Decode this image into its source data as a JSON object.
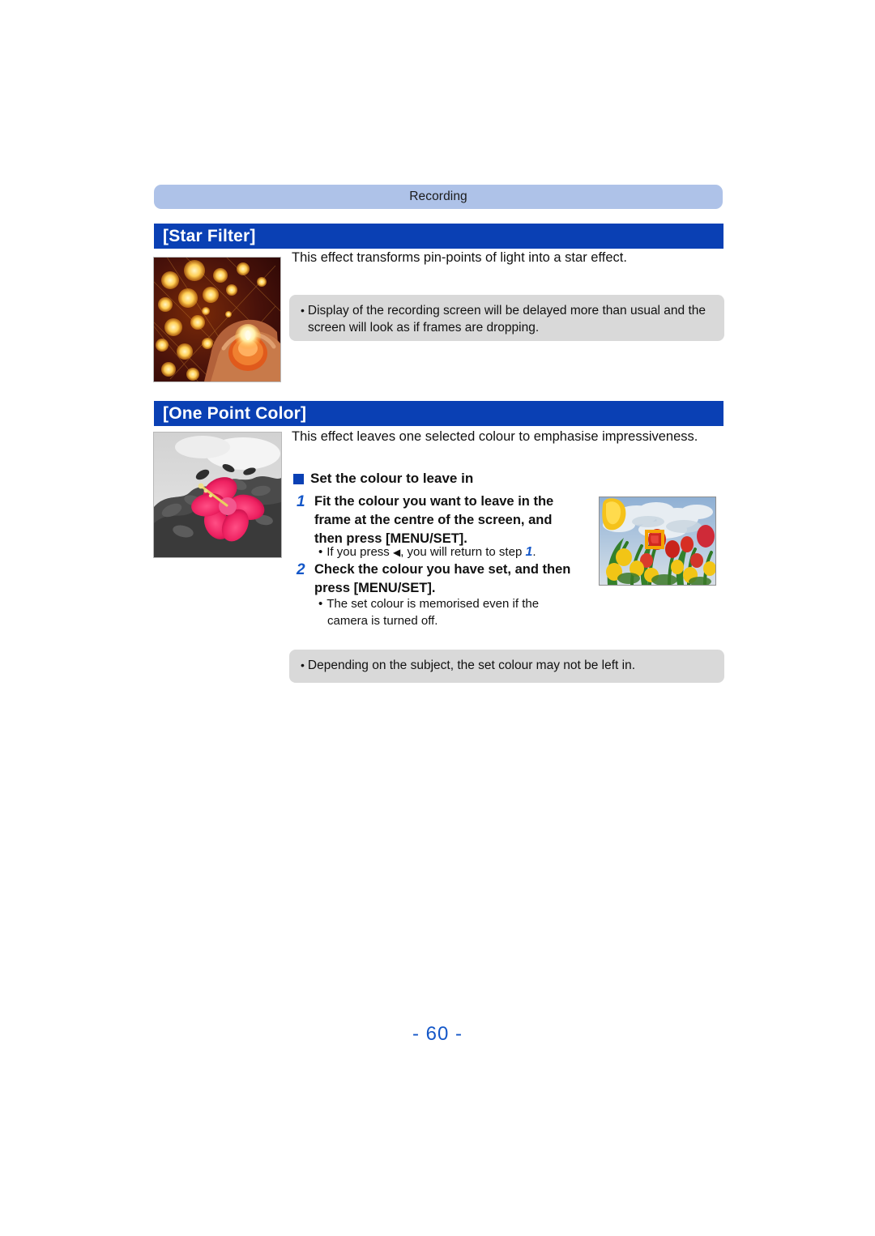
{
  "document": {
    "running_head": "Recording",
    "page_number": "- 60 -"
  },
  "sections": [
    {
      "title": "[Star Filter]",
      "description": "This effect transforms pin-points of light into a star effect.",
      "photo": {
        "name": "star-filter-sample-photo",
        "caption": "Candle held in cupped hands surrounded by golden star-shaped bokeh lights"
      },
      "note": {
        "line1": "Display of the recording screen will be delayed more than usual and the",
        "line2": "screen will look as if frames are dropping."
      }
    },
    {
      "title": "[One Point Color]",
      "description": "This effect leaves one selected colour to emphasise impressiveness.",
      "photo": {
        "name": "one-point-color-sample-photo",
        "caption": "Monochrome foliage with a single pink hibiscus flower in colour"
      },
      "subheading": "Set the colour to leave in",
      "steps": [
        {
          "number": "1",
          "lines": [
            "Fit the colour you want to leave in the",
            "frame at the centre of the screen, and",
            "then press [MENU/SET]."
          ],
          "sub_bullet": {
            "prefix": "If you press",
            "arrow": "◀",
            "middle": ", you will return to step",
            "ref_number": "1",
            "suffix": "."
          }
        },
        {
          "number": "2",
          "lines": [
            "Check the colour you have set, and then",
            "press [MENU/SET]."
          ],
          "sub_bullet_lines": [
            "The set colour is memorised even if the",
            "camera is turned off."
          ]
        }
      ],
      "screen_photo": {
        "name": "camera-screen-tulip-field",
        "caption": "Tulip field on camera live view with a yellow focus frame at the centre"
      },
      "note": {
        "line1": "Depending on the subject, the set colour may not be left in."
      }
    }
  ],
  "colors": {
    "section_bar": "#0a40b4",
    "running_head_band": "#aec2e8",
    "note_box": "#d9d9d9",
    "accent_blue": "#1457c8",
    "focus_frame": "#f5a300"
  }
}
